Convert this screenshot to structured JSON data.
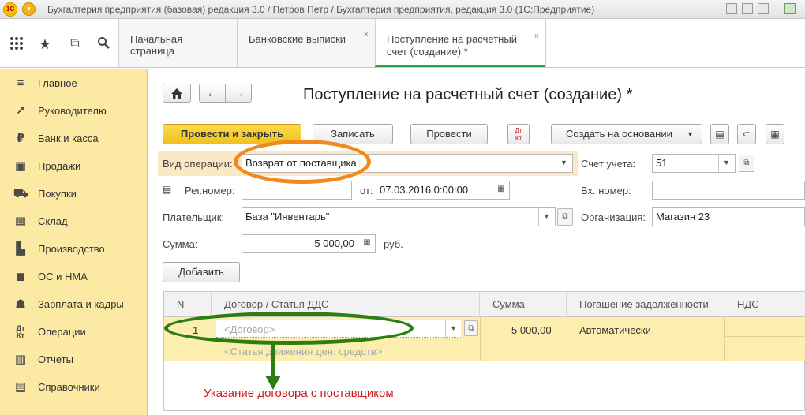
{
  "window": {
    "app_logo": "1С",
    "title": "Бухгалтерия предприятия (базовая) редакция 3.0 / Петров Петр / Бухгалтерия предприятия, редакция 3.0  (1С:Предприятие)"
  },
  "tabs": [
    {
      "label": "Начальная страница",
      "closable": false
    },
    {
      "label": "Банковские выписки",
      "closable": true
    },
    {
      "label_line1": "Поступление на расчетный",
      "label_line2": "счет (создание) *",
      "closable": true,
      "active": true
    }
  ],
  "toolbar_icons": [
    "apps-grid-icon",
    "star-icon",
    "history-icon",
    "search-icon"
  ],
  "sidebar": {
    "items": [
      {
        "label": "Главное",
        "icon": "list-icon"
      },
      {
        "label": "Руководителю",
        "icon": "trend-icon"
      },
      {
        "label": "Банк и касса",
        "icon": "ruble-icon"
      },
      {
        "label": "Продажи",
        "icon": "bag-icon"
      },
      {
        "label": "Покупки",
        "icon": "cart-icon"
      },
      {
        "label": "Склад",
        "icon": "warehouse-icon"
      },
      {
        "label": "Производство",
        "icon": "factory-icon"
      },
      {
        "label": "ОС и НМА",
        "icon": "truck-icon"
      },
      {
        "label": "Зарплата и кадры",
        "icon": "people-icon"
      },
      {
        "label": "Операции",
        "icon": "debit-credit-icon"
      },
      {
        "label": "Отчеты",
        "icon": "chart-icon"
      },
      {
        "label": "Справочники",
        "icon": "book-icon"
      }
    ]
  },
  "form": {
    "title": "Поступление на расчетный счет (создание) *",
    "buttons": {
      "post_and_close": "Провести и закрыть",
      "save": "Записать",
      "post": "Провести",
      "create_based_on": "Создать на основании",
      "add": "Добавить"
    },
    "operation_type_label": "Вид операции:",
    "operation_type_value": "Возврат от поставщика",
    "account_label": "Счет учета:",
    "account_value": "51",
    "reg_number_label": "Рег.номер:",
    "reg_number_value": "",
    "date_label": "от:",
    "date_value": "07.03.2016  0:00:00",
    "incoming_number_label": "Вх. номер:",
    "incoming_number_value": "",
    "payer_label": "Плательщик:",
    "payer_value": "База \"Инвентарь\"",
    "organization_label": "Организация:",
    "organization_value": "Магазин 23",
    "sum_label": "Сумма:",
    "sum_value": "5 000,00",
    "currency": "руб."
  },
  "table": {
    "columns": [
      "N",
      "Договор / Статья ДДС",
      "Сумма",
      "Погашение задолженности",
      "НДС"
    ],
    "rows": [
      {
        "n": "1",
        "contract_placeholder": "<Договор>",
        "cash_flow_placeholder": "<Статья движения ден. средств>",
        "sum": "5 000,00",
        "repayment": "Автоматически"
      }
    ]
  },
  "annotation": {
    "caption": "Указание договора с поставщиком",
    "orange": "#f08a1c",
    "green": "#2e7d12",
    "red": "#cc1a1a"
  }
}
